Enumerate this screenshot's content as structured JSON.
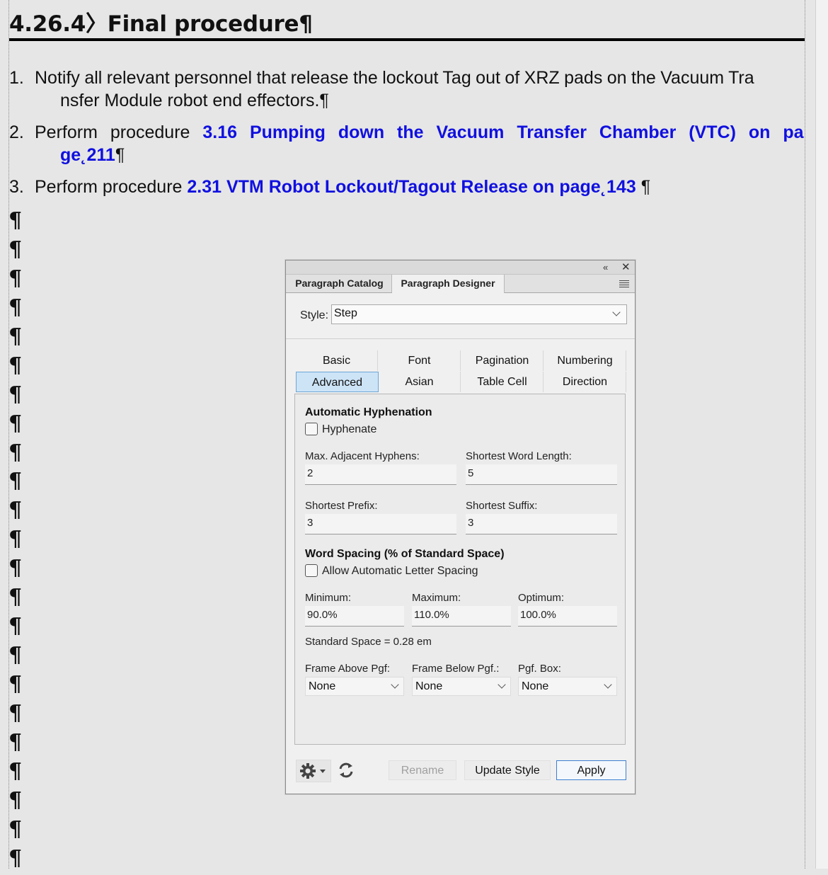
{
  "document": {
    "heading": "4.26.4〉Final procedure¶",
    "steps": [
      {
        "number": "1.",
        "line1": "Notify all relevant personnel that release the lockout Tag out of XRZ pads on the Vacuum Tra",
        "line2": "nsfer Module robot end effectors.¶"
      },
      {
        "number": "2.",
        "prefix": "Perform procedure ",
        "link_line1": "3.16 Pumping down the Vacuum Transfer Chamber (VTC) on pa",
        "link_line2": "ge˛211",
        "suffix": "¶"
      },
      {
        "number": "3.",
        "prefix": "Perform procedure ",
        "link": "2.31 VTM Robot Lockout/Tagout Release on page˛143",
        "suffix": " ¶"
      }
    ],
    "empty_paragraph_mark": "¶",
    "empty_paragraph_count": 23
  },
  "dialog": {
    "titlebar": {
      "collapse_icon": "collapse-arrows-icon",
      "close_icon": "close-icon"
    },
    "panel_tabs": [
      "Paragraph Catalog",
      "Paragraph Designer"
    ],
    "active_panel_tab": "Paragraph Designer",
    "menu_icon": "panel-menu-icon",
    "style_label": "Style:",
    "style_value": "Step",
    "section_tabs_row1": [
      "Basic",
      "Font",
      "Pagination",
      "Numbering"
    ],
    "section_tabs_row2": [
      "Advanced",
      "Asian",
      "Table Cell",
      "Direction"
    ],
    "active_section_tab": "Advanced",
    "hyphenation": {
      "title": "Automatic Hyphenation",
      "hyphenate_label": "Hyphenate",
      "hyphenate_checked": false,
      "max_adjacent_label": "Max. Adjacent Hyphens:",
      "max_adjacent_value": "2",
      "shortest_word_label": "Shortest Word Length:",
      "shortest_word_value": "5",
      "shortest_prefix_label": "Shortest Prefix:",
      "shortest_prefix_value": "3",
      "shortest_suffix_label": "Shortest Suffix:",
      "shortest_suffix_value": "3"
    },
    "word_spacing": {
      "title": "Word Spacing (% of Standard Space)",
      "allow_letter_spacing_label": "Allow Automatic Letter Spacing",
      "allow_letter_spacing_checked": false,
      "minimum_label": "Minimum:",
      "minimum_value": "90.0%",
      "maximum_label": "Maximum:",
      "maximum_value": "110.0%",
      "optimum_label": "Optimum:",
      "optimum_value": "100.0%",
      "standard_space": "Standard Space = 0.28 em"
    },
    "frames": {
      "frame_above_label": "Frame Above Pgf:",
      "frame_above_value": "None",
      "frame_below_label": "Frame Below Pgf.:",
      "frame_below_value": "None",
      "pgf_box_label": "Pgf. Box:",
      "pgf_box_value": "None"
    },
    "footer": {
      "settings_icon": "gear-icon",
      "refresh_icon": "refresh-icon",
      "rename_label": "Rename",
      "update_style_label": "Update Style",
      "apply_label": "Apply"
    }
  },
  "colors": {
    "link": "#1010e0",
    "background": "#e6e6e6",
    "active_tab": "#cde4f7"
  }
}
